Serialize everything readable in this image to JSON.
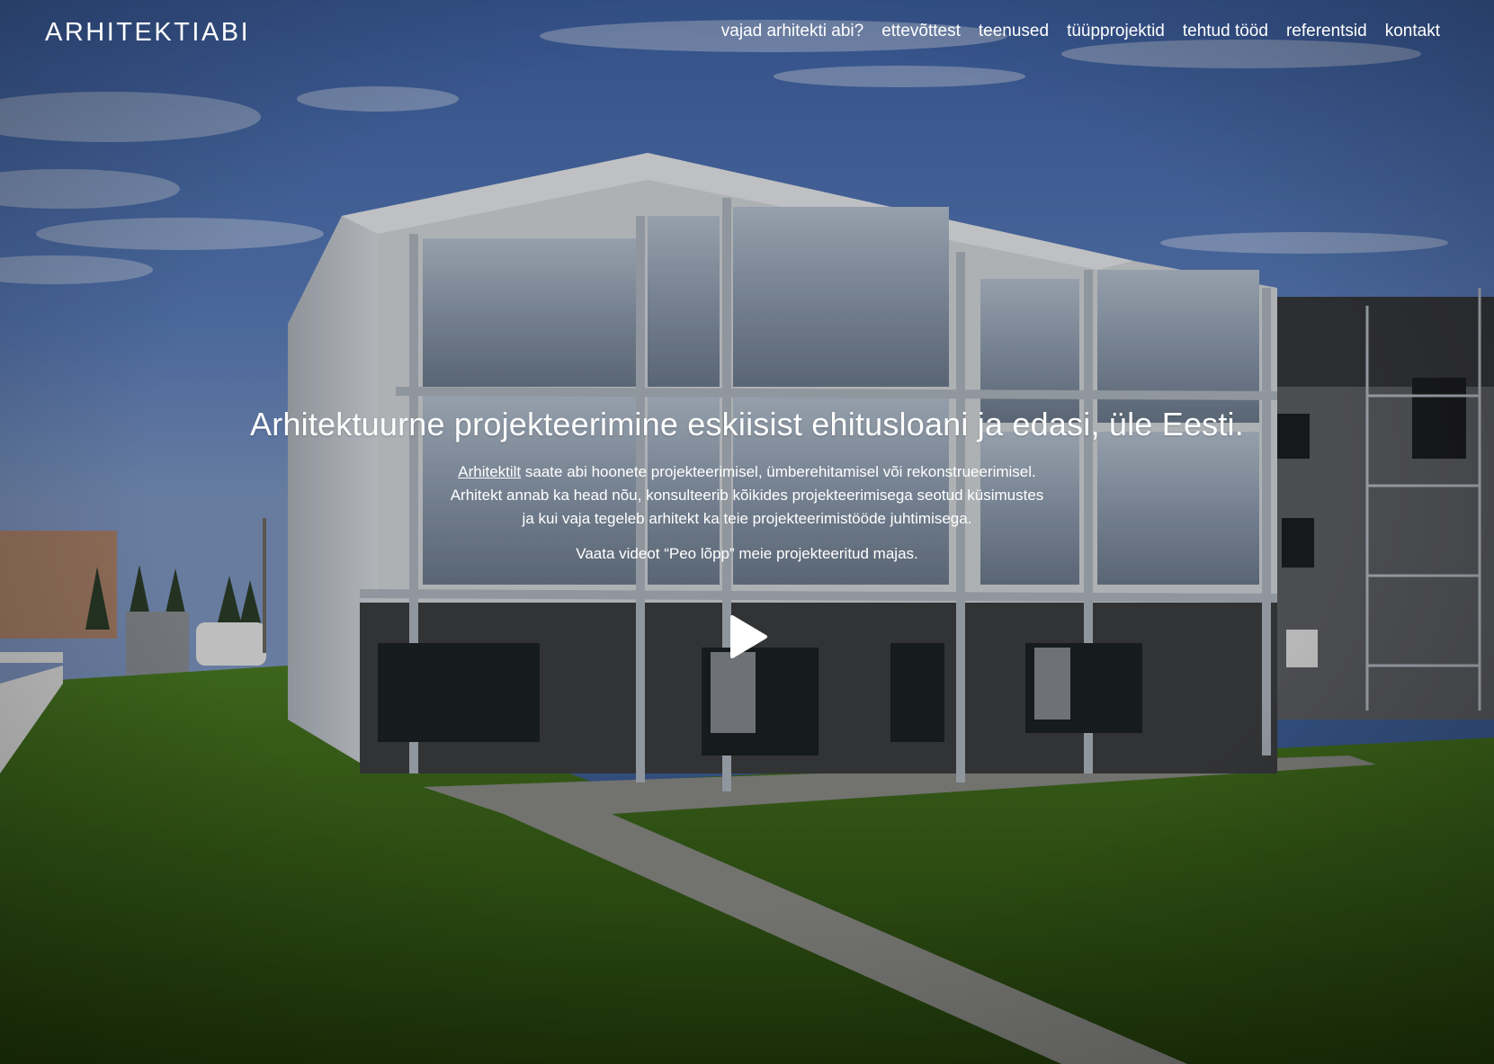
{
  "brand": {
    "logo_text": "ARHITEKTIABI"
  },
  "nav": {
    "items": [
      "vajad arhitekti abi?",
      "ettevõttest",
      "teenused",
      "tüüpprojektid",
      "tehtud tööd",
      "referentsid",
      "kontakt"
    ]
  },
  "hero": {
    "headline": "Arhitektuurne projekteerimine eskiisist ehitusloani ja edasi, üle Eesti.",
    "intro_link": "Arhitektilt",
    "intro_line1_rest": " saate abi hoonete projekteerimisel, ümberehitamisel või rekonstrueerimisel.",
    "intro_line2": "Arhitekt annab ka head nõu, konsulteerib kõikides projekteerimisega seotud küsimustes",
    "intro_line3": "ja kui vaja tegeleb arhitekt ka teie projekteerimistööde juhtimisega.",
    "video_text": "Vaata videot “Peo lõpp” meie projekteeritud majas."
  },
  "icons": {
    "play": "play-icon"
  },
  "colors": {
    "text": "#ffffff",
    "sky_top": "#2f4f8f",
    "grass": "#3c6a1c"
  }
}
